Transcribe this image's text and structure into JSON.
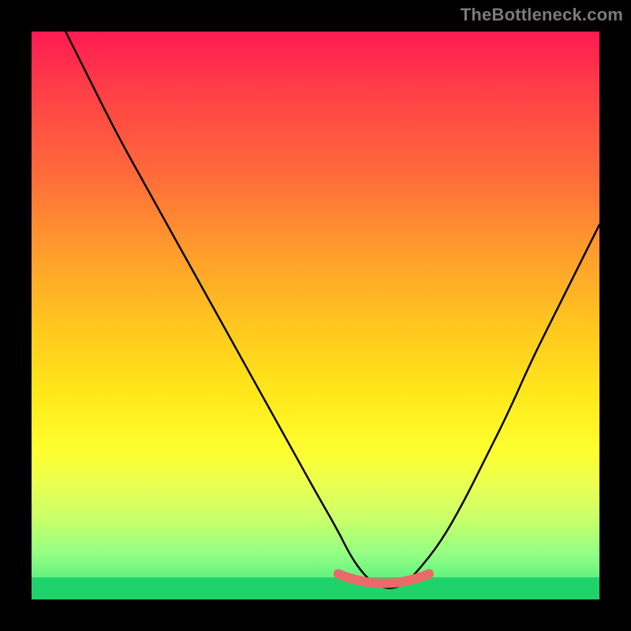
{
  "watermark": "TheBottleneck.com",
  "chart_data": {
    "type": "line",
    "title": "",
    "xlabel": "",
    "ylabel": "",
    "xlim": [
      0,
      100
    ],
    "ylim": [
      0,
      100
    ],
    "series": [
      {
        "name": "curve",
        "x": [
          6,
          10,
          15,
          20,
          25,
          30,
          35,
          40,
          45,
          50,
          54,
          56,
          58,
          60,
          62,
          64,
          66,
          68,
          72,
          76,
          80,
          84,
          88,
          92,
          96,
          100
        ],
        "y": [
          100,
          92,
          82,
          73,
          64,
          55,
          46,
          37,
          28,
          19,
          12,
          8,
          5,
          3,
          2,
          2,
          3,
          5,
          10,
          17,
          25,
          33,
          42,
          50,
          58,
          66
        ]
      }
    ],
    "trough_highlight": {
      "x_start": 54,
      "x_end": 70,
      "y_approx": 2
    },
    "background_gradient": {
      "orientation": "vertical_top_to_bottom",
      "stops": [
        {
          "pos": 0.0,
          "color": "#ff1a52"
        },
        {
          "pos": 0.25,
          "color": "#ff6a3a"
        },
        {
          "pos": 0.52,
          "color": "#ffc71f"
        },
        {
          "pos": 0.74,
          "color": "#fdff30"
        },
        {
          "pos": 0.92,
          "color": "#92ff84"
        },
        {
          "pos": 1.0,
          "color": "#38e67a"
        }
      ]
    }
  }
}
